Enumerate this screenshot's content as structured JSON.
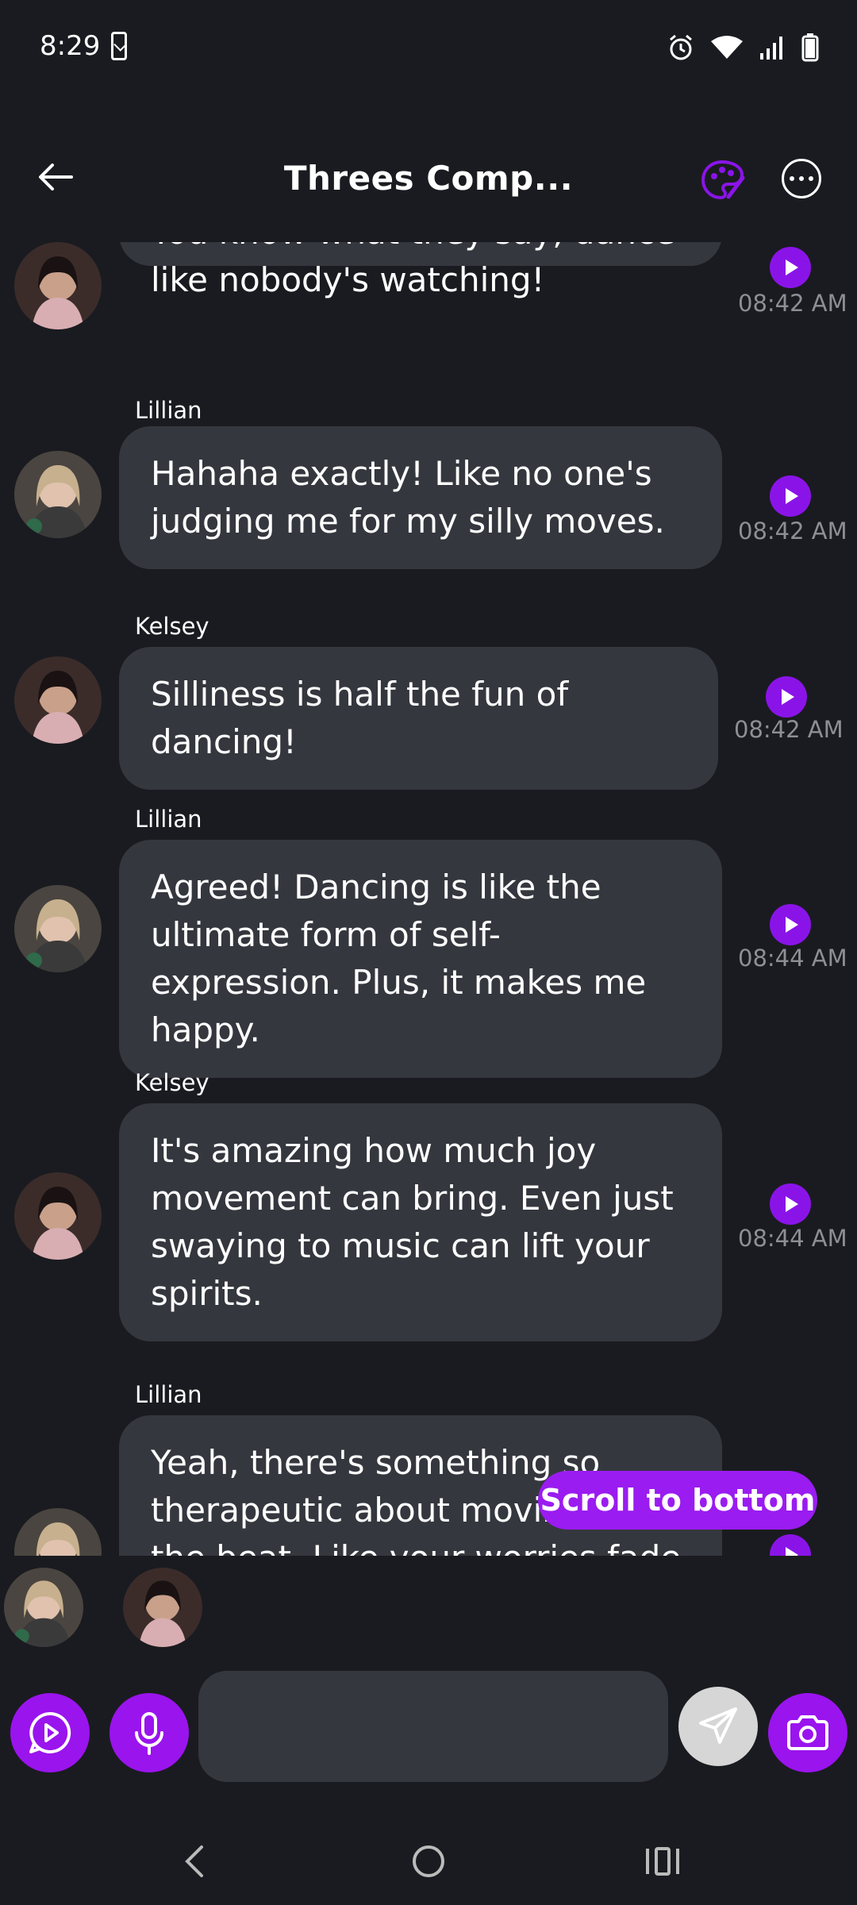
{
  "status_bar": {
    "time": "8:29",
    "icons": [
      "phone-check-icon",
      "alarm-icon",
      "wifi-icon",
      "signal-icon",
      "battery-icon"
    ]
  },
  "header": {
    "title": "Threes Comp...",
    "accent_color": "#8a14e8"
  },
  "messages": [
    {
      "sender": "",
      "text": "You know what they say, dance like nobody's watching!",
      "time": "08:42 AM",
      "avatar": "kelsey"
    },
    {
      "sender": "Lillian",
      "text": "Hahaha exactly! Like no one's judging me for my silly moves.",
      "time": "08:42 AM",
      "avatar": "lillian"
    },
    {
      "sender": "Kelsey",
      "text": "Silliness is half the fun of dancing!",
      "time": "08:42 AM",
      "avatar": "kelsey"
    },
    {
      "sender": "Lillian",
      "text": "Agreed! Dancing is like the ultimate form of self-expression. Plus, it makes me happy.",
      "time": "08:44 AM",
      "avatar": "lillian"
    },
    {
      "sender": "Kelsey",
      "text": "It's amazing how much joy movement can bring. Even just swaying to music can lift your spirits.",
      "time": "08:44 AM",
      "avatar": "kelsey"
    },
    {
      "sender": "Lillian",
      "text": "Yeah, there's something so therapeutic about moving to the beat. Like your worries fade",
      "time": "",
      "avatar": "lillian"
    }
  ],
  "scroll_to_bottom_label": "Scroll to bottom",
  "composer": {
    "input_value": "",
    "input_placeholder": ""
  }
}
